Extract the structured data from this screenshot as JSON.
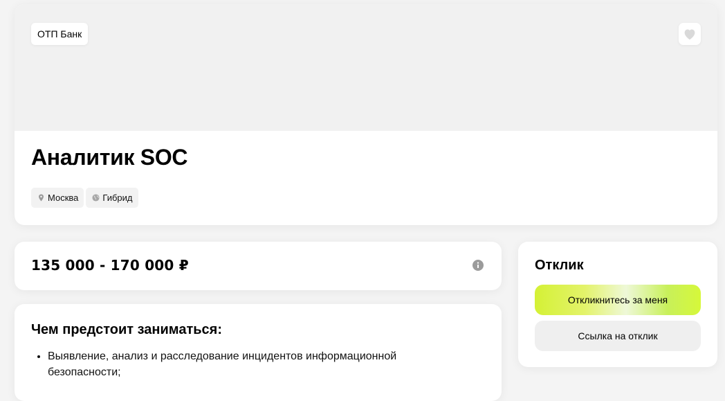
{
  "header": {
    "company": "ОТП Банк",
    "title": "Аналитик SOC",
    "tags": [
      {
        "icon": "location-pin-icon",
        "label": "Москва"
      },
      {
        "icon": "globe-icon",
        "label": "Гибрид"
      }
    ],
    "favorite_icon": "heart-icon"
  },
  "salary": {
    "text": "135 000 - 170 000 ₽",
    "info_icon": "info-icon"
  },
  "description": {
    "heading": "Чем предстоит заниматься:",
    "items": [
      "Выявление, анализ и расследование инцидентов информационной безопасности;"
    ]
  },
  "response": {
    "title": "Отклик",
    "primary_button": "Откликнитесь за меня",
    "secondary_button": "Ссылка на отклик"
  },
  "colors": {
    "page_bg": "#f4f4f4",
    "banner_bg": "#f1f1f1",
    "accent": "#d4f135",
    "secondary_button_bg": "#efefef"
  }
}
